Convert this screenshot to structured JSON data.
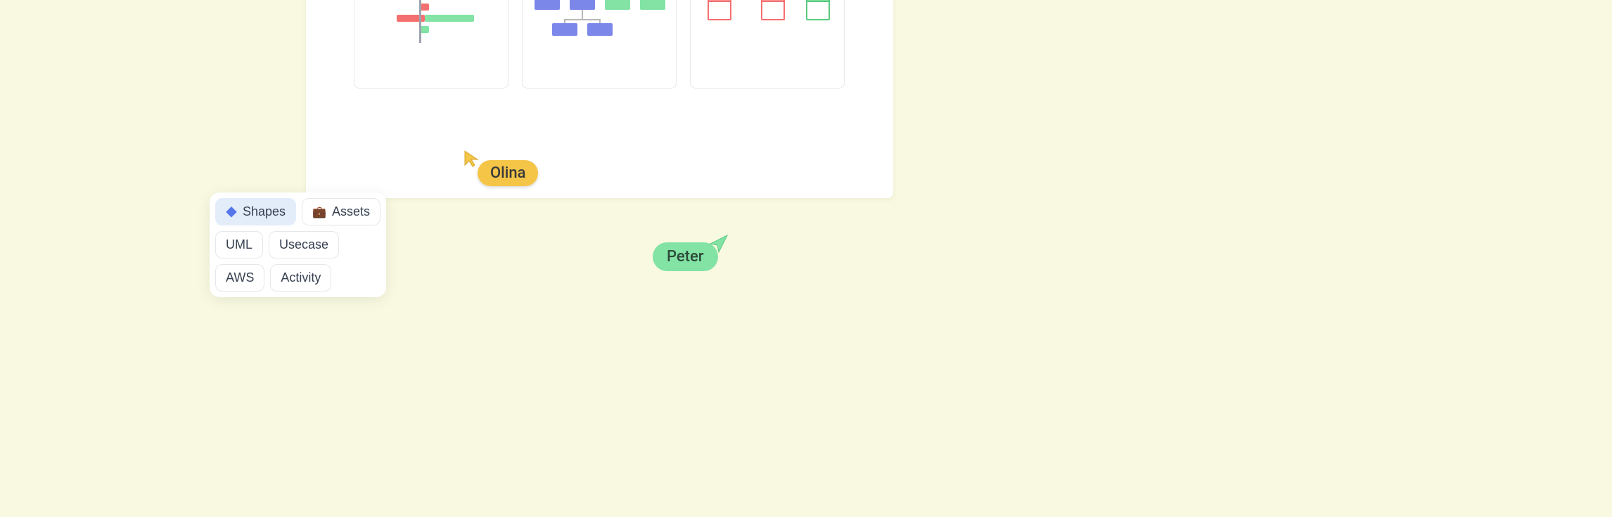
{
  "cursors": {
    "olina": {
      "label": "Olina",
      "color": "#f5c547"
    },
    "peter": {
      "label": "Peter",
      "color": "#82e3a5"
    }
  },
  "toolbox": {
    "shapes": {
      "label": "Shapes",
      "active": true
    },
    "assets": {
      "label": "Assets",
      "active": false
    },
    "categories": {
      "uml": "UML",
      "usecase": "Usecase",
      "aws": "AWS",
      "activity": "Activity"
    }
  },
  "templates": {
    "template1": {
      "type": "gantt"
    },
    "template2": {
      "type": "org-chart-filled"
    },
    "template3": {
      "type": "org-chart-outline"
    }
  }
}
